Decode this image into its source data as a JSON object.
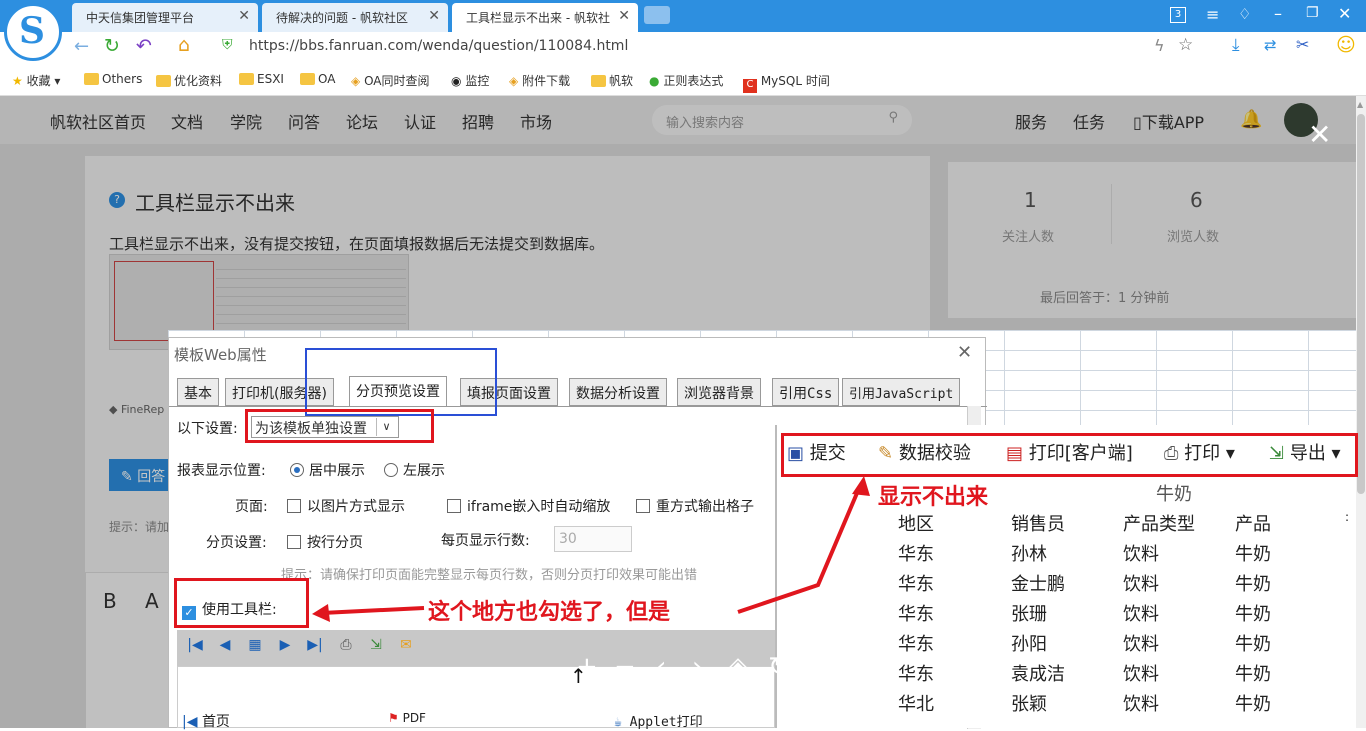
{
  "browser": {
    "tabs": [
      {
        "title": "中天信集团管理平台"
      },
      {
        "title": "待解决的问题 - 帆软社区"
      },
      {
        "title": "工具栏显示不出来 - 帆软社"
      }
    ],
    "tab_count": "3",
    "url": "https://bbs.fanruan.com/wenda/question/110084.html",
    "bookmarks": [
      "收藏",
      "Others",
      "优化资料",
      "ESXI",
      "OA",
      "OA同时查阅",
      "监控",
      "附件下载",
      "帆软",
      "正则表达式",
      "MySQL 时间"
    ]
  },
  "site_nav": {
    "items": [
      "帆软社区首页",
      "文档",
      "学院",
      "问答",
      "论坛",
      "认证",
      "招聘",
      "市场"
    ],
    "search_placeholder": "输入搜索内容",
    "right_items": [
      "服务",
      "任务",
      "下载APP"
    ]
  },
  "question": {
    "title": "工具栏显示不出来",
    "body": "工具栏显示不出来，没有提交按钮，在页面填报数据后无法提交到数据库。",
    "tag": "FineRep",
    "answer_btn": "回答",
    "hint": "提示：请加",
    "editor_b": "B",
    "editor_a": "A"
  },
  "stats": {
    "follow_count": "1",
    "follow_label": "关注人数",
    "view_count": "6",
    "view_label": "浏览人数",
    "last_reply": "最后回答于：1 分钟前"
  },
  "dialog": {
    "title": "模板Web属性",
    "tabs": [
      "基本",
      "打印机(服务器)",
      "分页预览设置",
      "填报页面设置",
      "数据分析设置",
      "浏览器背景",
      "引用Css",
      "引用JavaScript"
    ],
    "setting_label": "以下设置:",
    "setting_value": "为该模板单独设置",
    "position_label": "报表显示位置:",
    "pos_center": "居中展示",
    "pos_left": "左展示",
    "page_label": "页面:",
    "opt_image": "以图片方式显示",
    "opt_iframe": "iframe嵌入时自动缩放",
    "opt_repeat": "重方式输出格子",
    "paging_label": "分页设置:",
    "opt_rowpage": "按行分页",
    "rows_label": "每页显示行数:",
    "rows_value": "30",
    "tip": "提示：请确保打印页面能完整显示每页行数，否则分页打印效果可能出错",
    "use_toolbar": "使用工具栏:",
    "first_page": "首页",
    "pdf": "PDF",
    "applet": "Applet打印"
  },
  "preview": {
    "toolbar": [
      "提交",
      "数据校验",
      "打印[客户端]",
      "打印",
      "导出"
    ],
    "report_title": "牛奶",
    "headers": [
      "地区",
      "销售员",
      "产品类型",
      "产品"
    ],
    "rows": [
      [
        "华东",
        "孙林",
        "饮料",
        "牛奶"
      ],
      [
        "华东",
        "金士鹏",
        "饮料",
        "牛奶"
      ],
      [
        "华东",
        "张珊",
        "饮料",
        "牛奶"
      ],
      [
        "华东",
        "孙阳",
        "饮料",
        "牛奶"
      ],
      [
        "华东",
        "袁成洁",
        "饮料",
        "牛奶"
      ],
      [
        "华北",
        "张颖",
        "饮料",
        "牛奶"
      ]
    ]
  },
  "annotations": {
    "not_showing": "显示不出来",
    "also_checked": "这个地方也勾选了，但是"
  },
  "colors": {
    "accent": "#2d8fe0",
    "annotation_red": "#e0161e",
    "highlight_blue": "#2a4fd6"
  }
}
